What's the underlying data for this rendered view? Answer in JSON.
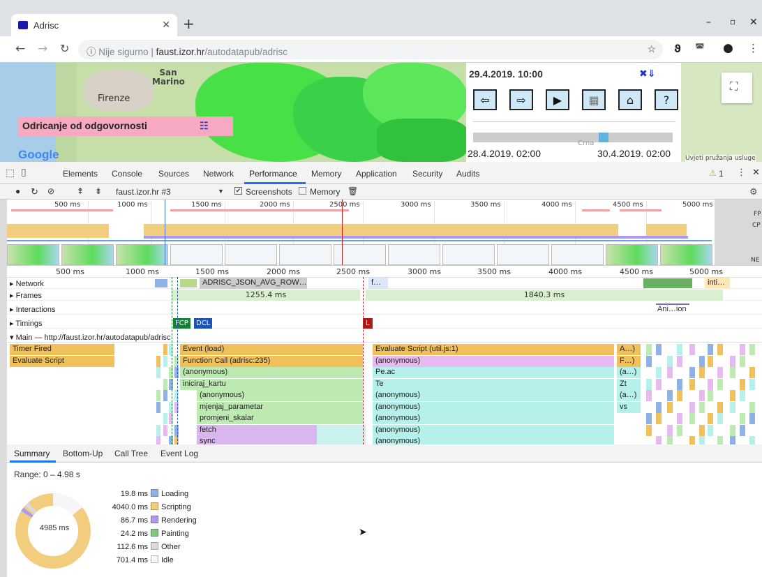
{
  "browser": {
    "tab_title": "Adrisc",
    "omnibox_security": "Nije sigurno",
    "omnibox_host": "faust.izor.hr",
    "omnibox_path": "/autodatapub/adrisc"
  },
  "page": {
    "map_labels": [
      "San Marino",
      "Firenze",
      "Crna"
    ],
    "disclaimer": "Odricanje od odgovornosti",
    "current_date": "29.4.2019. 10:00",
    "date_start": "28.4.2019. 02:00",
    "date_end": "30.4.2019. 02:00",
    "buttons": [
      "⇦",
      "⇨",
      "▶",
      "▦",
      "⌂",
      "?"
    ],
    "google_logo": "Google",
    "terms": "Uvjeti pružanja usluge"
  },
  "devtools": {
    "tabs": [
      "Elements",
      "Console",
      "Sources",
      "Network",
      "Performance",
      "Memory",
      "Application",
      "Security",
      "Audits"
    ],
    "active_tab": "Performance",
    "warning_count": "1",
    "recording_select": "faust.izor.hr #3",
    "screenshots_label": "Screenshots",
    "memory_label": "Memory",
    "overview_side": [
      "FP",
      "CP",
      "NE"
    ]
  },
  "timeline": {
    "ruler_ms": [
      "500 ms",
      "1000 ms",
      "1500 ms",
      "2000 ms",
      "2500 ms",
      "3000 ms",
      "3500 ms",
      "4000 ms",
      "4500 ms",
      "5000 ms"
    ],
    "tracks": [
      "Network",
      "Frames",
      "Interactions",
      "Timings"
    ],
    "network_request": "ADRISC_JSON_AVG_ROW…",
    "network_f": "f…",
    "network_inti": "inti…",
    "frame_1": "1255.4 ms",
    "frame_2": "1840.3 ms",
    "interaction": "Ani…ion",
    "marker_fcp": "FCP",
    "marker_dcl": "DCL",
    "marker_l": "L",
    "main_thread": "Main — http://faust.izor.hr/autodatapub/adrisc",
    "events_left": [
      "Timer Fired",
      "Evaluate Script"
    ],
    "events_mid": [
      "Event (load)",
      "Function Call (adrisc:235)",
      "(anonymous)",
      "iniciraj_kartu",
      "(anonymous)",
      "mjenjaj_parametar",
      "promjeni_skalar",
      "fetch",
      "sync"
    ],
    "events_right": [
      "Evaluate Script (util.js:1)",
      "(anonymous)",
      "Pe.ac",
      "Te",
      "(anonymous)",
      "(anonymous)",
      "(anonymous)",
      "(anonymous)",
      "(anonymous)"
    ],
    "events_far": [
      "A…)",
      "F…)",
      "(a…)",
      "Zt",
      "(a…)",
      "vs"
    ]
  },
  "summary": {
    "tabs": [
      "Summary",
      "Bottom-Up",
      "Call Tree",
      "Event Log"
    ],
    "range": "Range: 0 – 4.98 s",
    "total": "4985 ms",
    "categories": [
      {
        "value": "19.8 ms",
        "label": "Loading",
        "color": "#8fb1e5"
      },
      {
        "value": "4040.0 ms",
        "label": "Scripting",
        "color": "#f3cd7e"
      },
      {
        "value": "86.7 ms",
        "label": "Rendering",
        "color": "#af99ed"
      },
      {
        "value": "24.2 ms",
        "label": "Painting",
        "color": "#7fc47f"
      },
      {
        "value": "112.6 ms",
        "label": "Other",
        "color": "#dadada"
      },
      {
        "value": "701.4 ms",
        "label": "Idle",
        "color": "#f6f6f6"
      }
    ]
  }
}
